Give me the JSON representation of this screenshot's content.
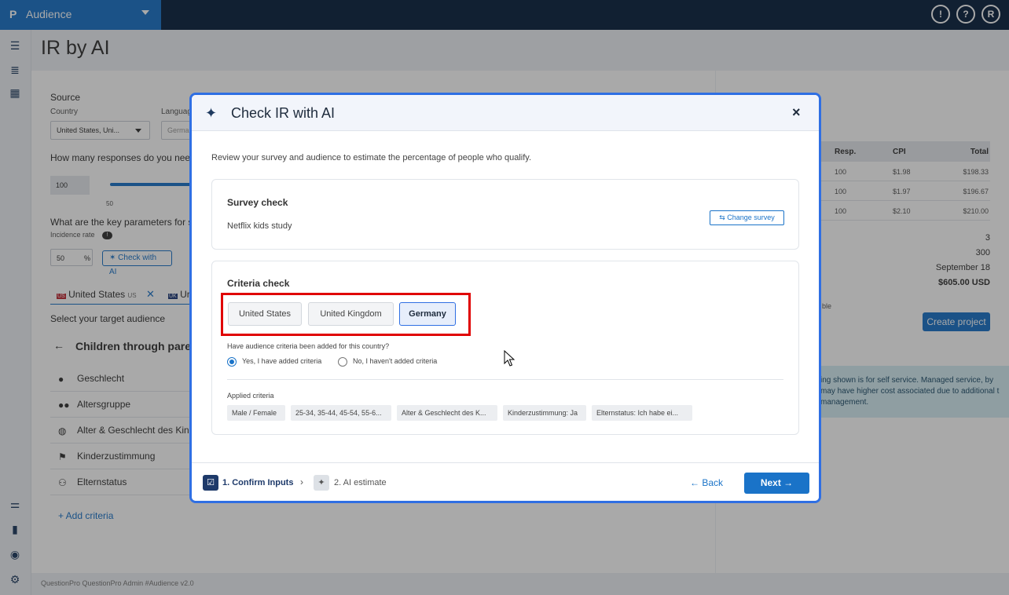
{
  "app": {
    "logo": "P",
    "name": "Audience",
    "help_icon_label": "?",
    "user_initial": "R"
  },
  "page": {
    "title": "IR by AI"
  },
  "left_panel": {
    "source_label": "Source",
    "country_label": "Country",
    "country_value": "United States, Uni...",
    "language_label": "Languag",
    "language_value": "Germa",
    "responses_question": "How many responses do you need?",
    "responses_value": "100",
    "slider_min": "50",
    "params_question": "What are the key parameters for su",
    "incidence_label": "Incidence rate",
    "incidence_value": "50",
    "incidence_unit": "%",
    "check_ai_label": "Check with AI",
    "country_tabs": [
      {
        "flag": "US",
        "label": "United States",
        "code": "US"
      },
      {
        "flag": "UK",
        "label": "Ur"
      }
    ],
    "target_label": "Select your target audience",
    "audience_title": "Children through pare",
    "criteria": [
      {
        "icon": "person-icon",
        "label": "Geschlecht"
      },
      {
        "icon": "group-icon",
        "label": "Altersgruppe"
      },
      {
        "icon": "age-gender-icon",
        "label": "Alter & Geschlecht des Kinde"
      },
      {
        "icon": "flag-icon",
        "label": "Kinderzustimmung"
      },
      {
        "icon": "family-icon",
        "label": "Elternstatus"
      }
    ],
    "add_criteria": "+ Add criteria"
  },
  "right_panel": {
    "table_headers": [
      "Resp.",
      "CPI",
      "Total"
    ],
    "rows": [
      {
        "resp": "100",
        "cpi": "$1.98",
        "total": "$198.33"
      },
      {
        "resp": "100",
        "cpi": "$1.97",
        "total": "$196.67"
      },
      {
        "resp": "100",
        "cpi": "$2.10",
        "total": "$210.00"
      }
    ],
    "summary": [
      "3",
      "300",
      "September 18",
      "$605.00 USD"
    ],
    "ble_text": "ble",
    "create_project": "Create project",
    "info_text": "ing shown is for self service. Managed service, by may have higher cost associated due to additional t management."
  },
  "footer": {
    "text": "QuestionPro QuestionPro Admin  #Audience v2.0"
  },
  "modal": {
    "title": "Check IR with AI",
    "close_label": "×",
    "description": "Review your survey and audience to estimate the percentage of people who qualify.",
    "survey_check": {
      "title": "Survey check",
      "survey_name": "Netflix kids study",
      "change_label": "Change survey"
    },
    "criteria_check": {
      "title": "Criteria check",
      "tabs": [
        {
          "label": "United States",
          "active": false
        },
        {
          "label": "United Kingdom",
          "active": false
        },
        {
          "label": "Germany",
          "active": true
        }
      ],
      "question": "Have audience criteria been added for this country?",
      "option_yes": "Yes, I have added criteria",
      "option_no": "No, I haven't added criteria",
      "applied_label": "Applied criteria",
      "chips": [
        "Male / Female",
        "25-34, 35-44, 45-54, 55-6...",
        "Alter & Geschlecht des K...",
        "Kinderzustimmung: Ja",
        "Elternstatus: Ich habe ei..."
      ]
    },
    "steps": [
      {
        "label": "1. Confirm Inputs",
        "active": true
      },
      {
        "label": "2. AI estimate",
        "active": false
      }
    ],
    "back_label": "Back",
    "next_label": "Next"
  },
  "colors": {
    "brand": "#1a73c8",
    "topbar": "#0a2240",
    "highlight": "#e00000",
    "modal_border": "#2f6fe3"
  }
}
